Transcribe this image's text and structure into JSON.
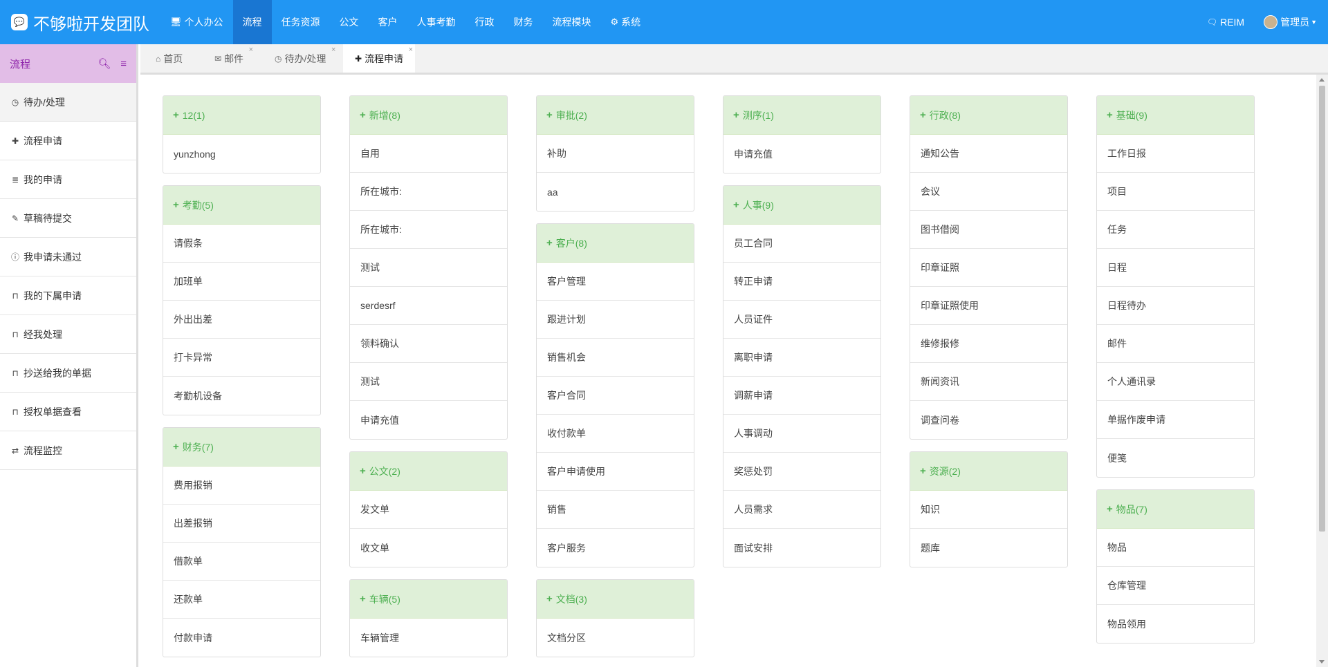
{
  "app": {
    "brand_icon": "chat-bubble-icon",
    "title": "不够啦开发团队",
    "accent_color": "#2196f3",
    "active_nav_color": "#1976d2",
    "panel_header_color": "#dff0d8",
    "panel_text_color": "#4caf50",
    "sidebar_header_color": "#e2bde7"
  },
  "topnav": {
    "items": [
      {
        "label": "个人办公",
        "icon": "monitor-icon"
      },
      {
        "label": "流程",
        "active": true
      },
      {
        "label": "任务资源"
      },
      {
        "label": "公文"
      },
      {
        "label": "客户"
      },
      {
        "label": "人事考勤"
      },
      {
        "label": "行政"
      },
      {
        "label": "财务"
      },
      {
        "label": "流程模块"
      },
      {
        "label": "系统",
        "icon": "gear-icon"
      }
    ],
    "reim": "REIM",
    "user": "管理员"
  },
  "sidebar": {
    "title": "流程",
    "items": [
      {
        "label": "待办/处理",
        "icon": "clock-icon"
      },
      {
        "label": "流程申请",
        "icon": "plus-icon"
      },
      {
        "label": "我的申请",
        "icon": "list-icon"
      },
      {
        "label": "草稿待提交",
        "icon": "edit-icon"
      },
      {
        "label": "我申请未通过",
        "icon": "info-icon"
      },
      {
        "label": "我的下属申请",
        "icon": "bookmark-icon"
      },
      {
        "label": "经我处理",
        "icon": "bookmark-icon"
      },
      {
        "label": "抄送给我的单据",
        "icon": "bookmark-icon"
      },
      {
        "label": "授权单据查看",
        "icon": "bookmark-icon"
      },
      {
        "label": "流程监控",
        "icon": "retweet-icon"
      }
    ]
  },
  "tabs": [
    {
      "label": "首页",
      "icon": "home-icon"
    },
    {
      "label": "邮件",
      "icon": "envelope-icon"
    },
    {
      "label": "待办/处理",
      "icon": "clock-icon"
    },
    {
      "label": "流程申请",
      "icon": "plus-icon",
      "active": true
    }
  ],
  "columns": [
    [
      {
        "title": "12(1)",
        "items": [
          "yunzhong"
        ]
      },
      {
        "title": "考勤(5)",
        "items": [
          "请假条",
          "加班单",
          "外出出差",
          "打卡异常",
          "考勤机设备"
        ]
      },
      {
        "title": "财务(7)",
        "items": [
          "费用报销",
          "出差报销",
          "借款单",
          "还款单",
          "付款申请"
        ]
      }
    ],
    [
      {
        "title": "新增(8)",
        "items": [
          "自用",
          "所在城市:",
          "所在城市:",
          "测试",
          "serdesrf",
          "领料确认",
          "测试",
          "申请充值"
        ]
      },
      {
        "title": "公文(2)",
        "items": [
          "发文单",
          "收文单"
        ]
      },
      {
        "title": "车辆(5)",
        "items": [
          "车辆管理"
        ]
      }
    ],
    [
      {
        "title": "审批(2)",
        "items": [
          "补助",
          "aa"
        ]
      },
      {
        "title": "客户(8)",
        "items": [
          "客户管理",
          "跟进计划",
          "销售机会",
          "客户合同",
          "收付款单",
          "客户申请使用",
          "销售",
          "客户服务"
        ]
      },
      {
        "title": "文档(3)",
        "items": [
          "文档分区"
        ]
      }
    ],
    [
      {
        "title": "测序(1)",
        "items": [
          "申请充值"
        ]
      },
      {
        "title": "人事(9)",
        "items": [
          "员工合同",
          "转正申请",
          "人员证件",
          "离职申请",
          "调薪申请",
          "人事调动",
          "奖惩处罚",
          "人员需求",
          "面试安排"
        ]
      }
    ],
    [
      {
        "title": "行政(8)",
        "items": [
          "通知公告",
          "会议",
          "图书借阅",
          "印章证照",
          "印章证照使用",
          "维修报修",
          "新闻资讯",
          "调查问卷"
        ]
      },
      {
        "title": "资源(2)",
        "items": [
          "知识",
          "题库"
        ]
      }
    ],
    [
      {
        "title": "基础(9)",
        "items": [
          "工作日报",
          "项目",
          "任务",
          "日程",
          "日程待办",
          "邮件",
          "个人通讯录",
          "单据作废申请",
          "便笺"
        ]
      },
      {
        "title": "物品(7)",
        "items": [
          "物品",
          "仓库管理",
          "物品领用"
        ]
      }
    ]
  ]
}
